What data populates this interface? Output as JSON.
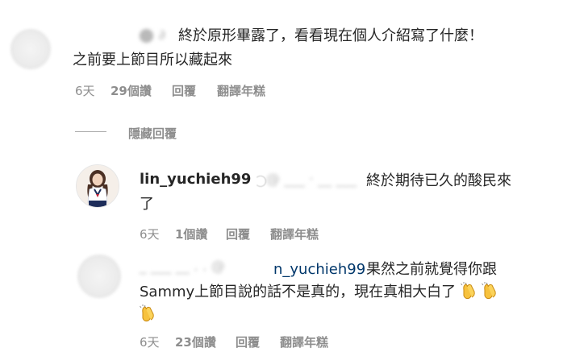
{
  "comment1": {
    "text_line1": "終於原形畢露了，看看現在個人介紹寫了什麼！",
    "text_line2": "之前要上節目所以藏起來",
    "time": "6天",
    "likes": "29個讚",
    "reply": "回覆",
    "see_translation": "翻譯年糕"
  },
  "hide_replies": {
    "label": "隱藏回覆"
  },
  "reply1": {
    "username": "lin_yuchieh99",
    "text_line1": "終於期待已久的酸民來",
    "text_line2": "了",
    "time": "6天",
    "likes": "1個讚",
    "reply": "回覆",
    "see_translation": "翻譯年糕"
  },
  "reply2": {
    "mention": "n_yuchieh99",
    "text_line1": "果然之前就覺得你跟",
    "text_line2": "Sammy上節目說的話不是真的，現在真相大白了",
    "time": "6天",
    "likes": "23個讚",
    "reply": "回覆",
    "see_translation": "翻譯年糕",
    "emoji": "clapping-hands"
  }
}
